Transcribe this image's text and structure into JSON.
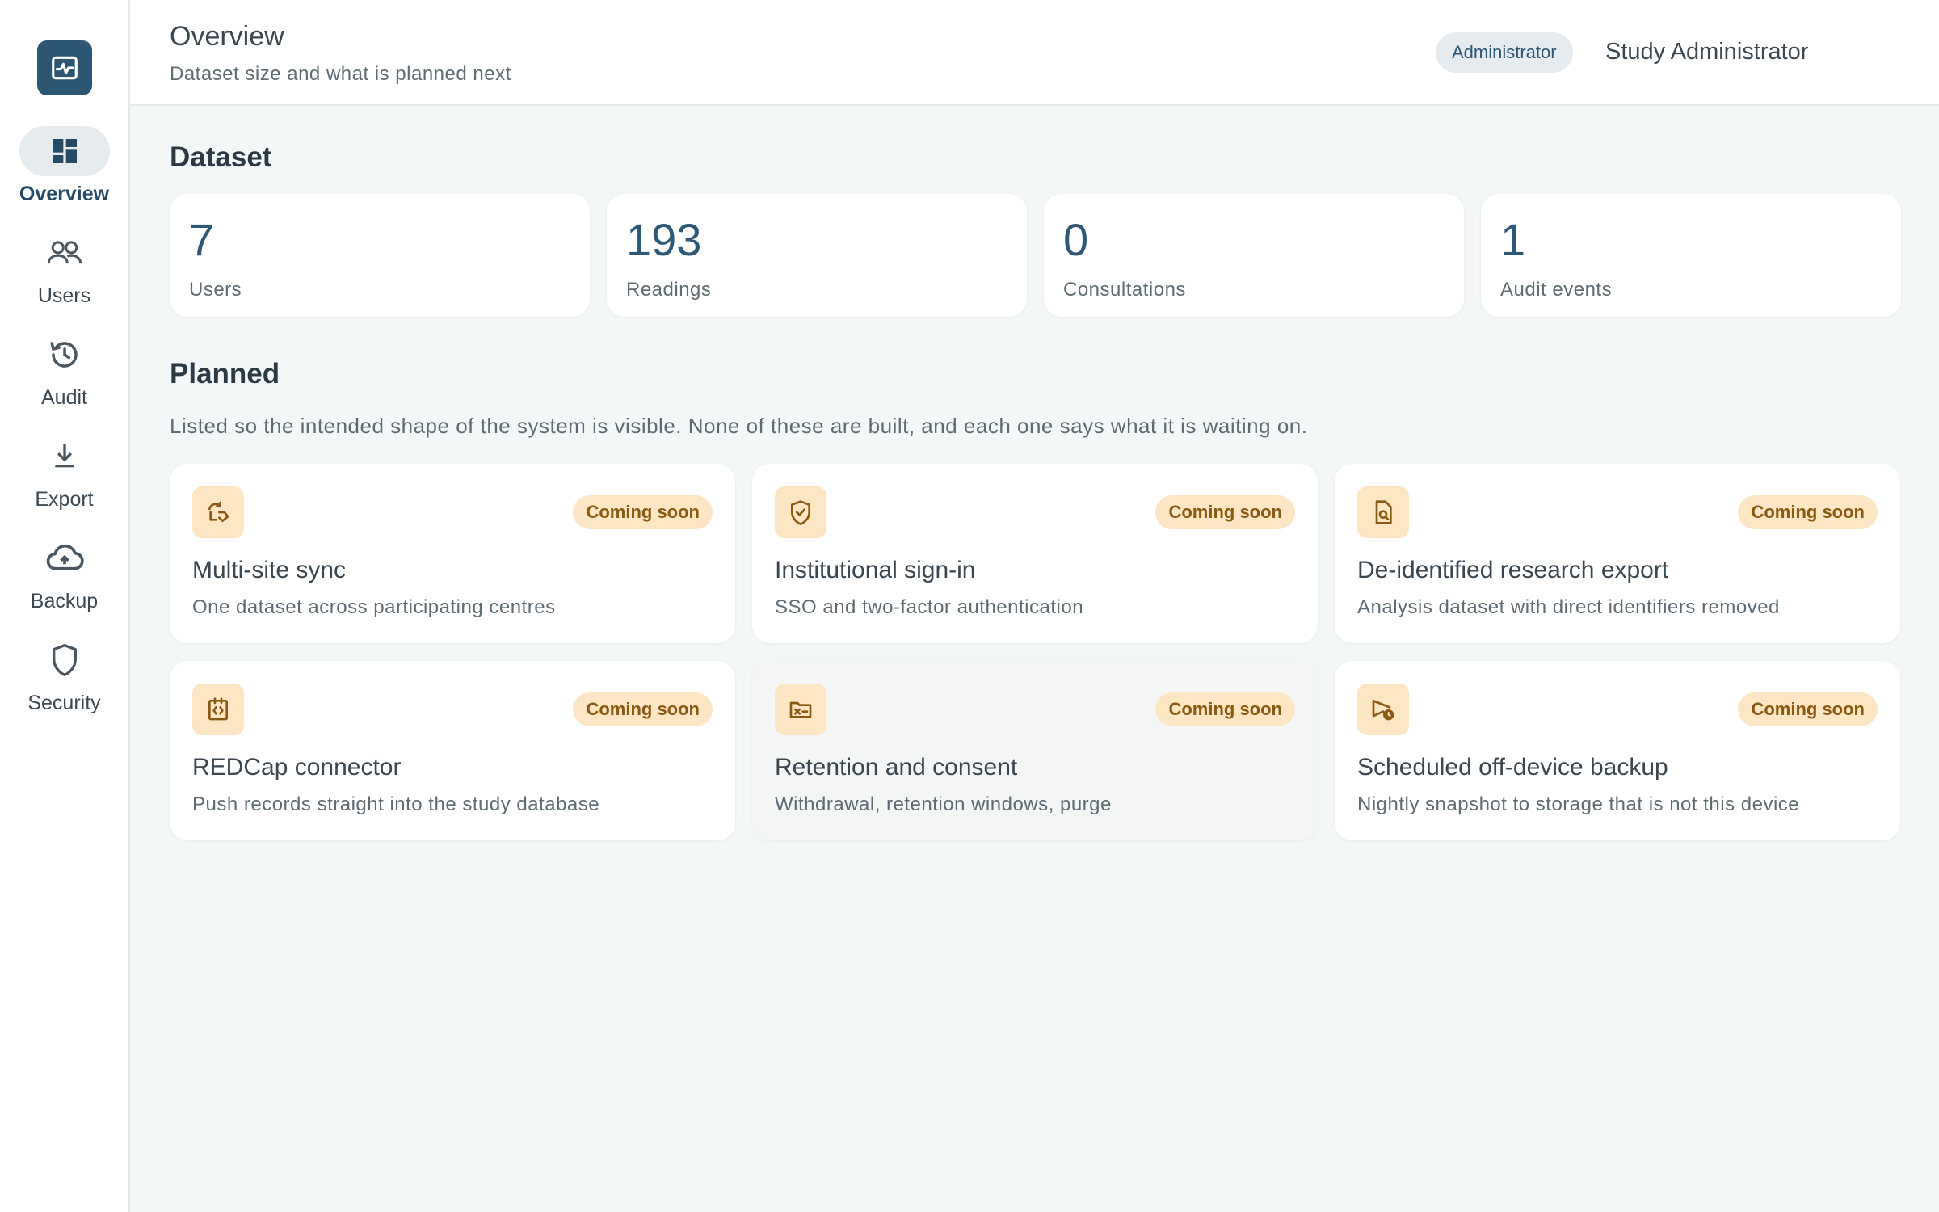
{
  "app": {
    "logo_icon": "pulse-chart-icon",
    "accent": "#2d5673"
  },
  "sidebar": {
    "items": [
      {
        "label": "Overview",
        "icon": "dashboard-icon",
        "active": true
      },
      {
        "label": "Users",
        "icon": "users-icon",
        "active": false
      },
      {
        "label": "Audit",
        "icon": "history-icon",
        "active": false
      },
      {
        "label": "Export",
        "icon": "download-icon",
        "active": false
      },
      {
        "label": "Backup",
        "icon": "cloud-upload-icon",
        "active": false
      },
      {
        "label": "Security",
        "icon": "shield-icon",
        "active": false
      }
    ]
  },
  "header": {
    "title": "Overview",
    "subtitle": "Dataset size and what is planned next",
    "role": "Administrator",
    "user": "Study Administrator",
    "logout_icon": "logout-icon"
  },
  "dataset": {
    "title": "Dataset",
    "stats": [
      {
        "value": "7",
        "label": "Users"
      },
      {
        "value": "193",
        "label": "Readings"
      },
      {
        "value": "0",
        "label": "Consultations"
      },
      {
        "value": "1",
        "label": "Audit events"
      }
    ]
  },
  "planned": {
    "title": "Planned",
    "description": "Listed so the intended shape of the system is visible. None of these are built, and each one says what it is waiting on.",
    "badge_color": "#fde6c4",
    "items": [
      {
        "title": "Multi-site sync",
        "desc": "One dataset across participating centres",
        "badge": "Coming soon",
        "icon": "sync-icon"
      },
      {
        "title": "Institutional sign-in",
        "desc": "SSO and two-factor authentication",
        "badge": "Coming soon",
        "icon": "shield-check-icon"
      },
      {
        "title": "De-identified research export",
        "desc": "Analysis dataset with direct identifiers removed",
        "badge": "Coming soon",
        "icon": "document-search-icon"
      },
      {
        "title": "REDCap connector",
        "desc": "Push records straight into the study database",
        "badge": "Coming soon",
        "icon": "code-clipboard-icon"
      },
      {
        "title": "Retention and consent",
        "desc": "Withdrawal, retention windows, purge",
        "badge": "Coming soon",
        "icon": "folder-x-icon"
      },
      {
        "title": "Scheduled off-device backup",
        "desc": "Nightly snapshot to storage that is not this device",
        "badge": "Coming soon",
        "icon": "scheduled-send-icon"
      }
    ]
  }
}
